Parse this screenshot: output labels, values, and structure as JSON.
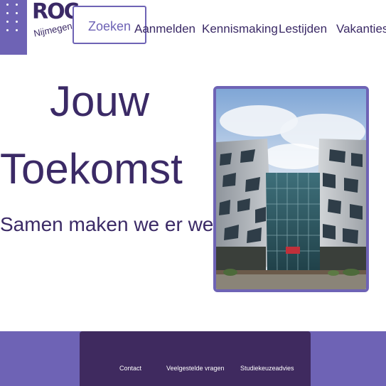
{
  "logo": {
    "brand": "ROC",
    "city": "Nijmegen"
  },
  "header": {
    "search_label": "Zoeken",
    "nav_items": [
      {
        "label": "Aanmelden"
      },
      {
        "label": "Kennismaking"
      },
      {
        "label": "Lestijden"
      },
      {
        "label": "Vakanties"
      }
    ]
  },
  "hero": {
    "title_line_1": "Jouw",
    "title_line_2": "Toekomst",
    "subtitle": "Samen maken we er werk van",
    "image_icon": "building-photo"
  },
  "footer": {
    "links": [
      {
        "label": "Contact"
      },
      {
        "label": "Veelgestelde vragen"
      },
      {
        "label": "Studiekeuzeadvies"
      }
    ]
  },
  "colors": {
    "brand_purple": "#6e63b5",
    "dark_purple": "#3b2a66",
    "footer_panel": "#3f2a5f",
    "background": "#ffffff"
  }
}
